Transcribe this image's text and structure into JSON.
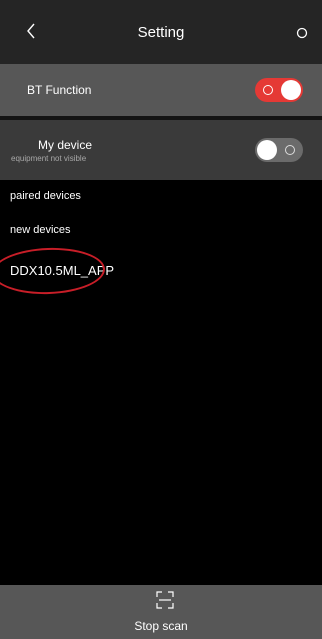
{
  "header": {
    "title": "Setting",
    "back_icon": "chevron-left-icon",
    "menu_icon": "circle-icon"
  },
  "bt_function": {
    "label": "BT Function",
    "toggle_state": "on",
    "toggle_color": "#e53935"
  },
  "my_device": {
    "label": "My device",
    "sublabel": "equipment not visible",
    "toggle_state": "off"
  },
  "sections": {
    "paired": "paired devices",
    "new": "new devices"
  },
  "devices": [
    {
      "name": "DDX10.5ML_APP"
    }
  ],
  "highlight_color": "#c81e28",
  "bottom_bar": {
    "scan_icon": "scan-icon",
    "label": "Stop scan"
  }
}
